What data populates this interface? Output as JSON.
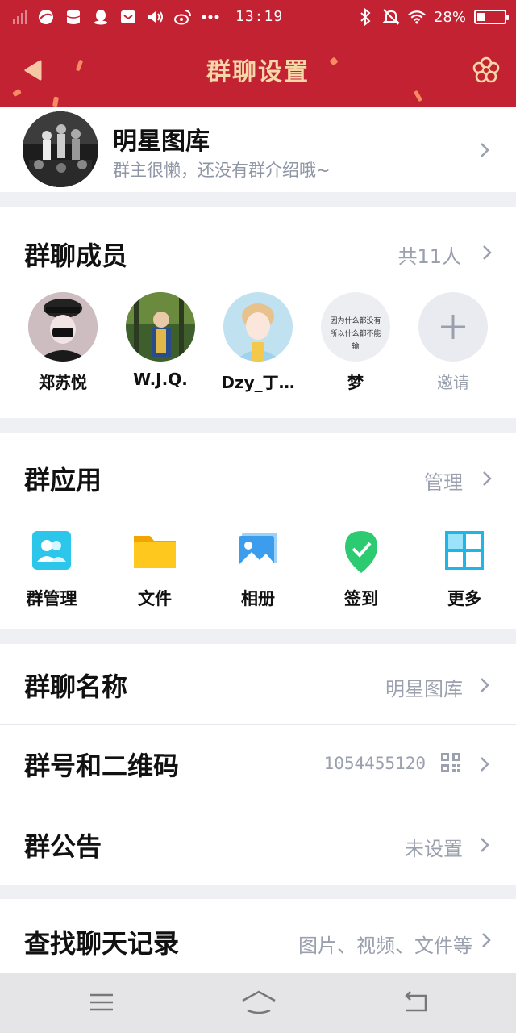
{
  "status_bar": {
    "time": "13:19",
    "battery_text": "28%",
    "battery_level": 0.28,
    "icons": [
      "signal-icon",
      "browser-icon",
      "storage-icon",
      "qq-icon",
      "mail-icon",
      "volume-icon",
      "weibo-icon",
      "more-dots-icon",
      "bluetooth-icon",
      "mute-icon",
      "wifi-icon",
      "battery-icon"
    ]
  },
  "header": {
    "title": "群聊设置"
  },
  "group": {
    "name": "明星图库",
    "description": "群主很懒，还没有群介绍哦~"
  },
  "members": {
    "title": "群聊成员",
    "count_label": "共11人",
    "list": [
      {
        "name": "郑苏悦"
      },
      {
        "name": "W.J.Q."
      },
      {
        "name": "Dzy_丁…"
      },
      {
        "name": "梦",
        "avatar_text": "因为什么都没有 所以什么都不能输"
      },
      {
        "name": "邀请"
      }
    ]
  },
  "apps": {
    "title": "群应用",
    "manage_label": "管理",
    "items": [
      {
        "label": "群管理",
        "icon": "group-manage-icon",
        "color": "#2cc6ea"
      },
      {
        "label": "文件",
        "icon": "folder-icon",
        "color": "#ffc11a"
      },
      {
        "label": "相册",
        "icon": "photo-album-icon",
        "color": "#4aa8ee"
      },
      {
        "label": "签到",
        "icon": "check-in-icon",
        "color": "#2ccb72"
      },
      {
        "label": "更多",
        "icon": "grid-more-icon",
        "color": "#1fb5e6"
      }
    ]
  },
  "settings": {
    "group_name": {
      "title": "群聊名称",
      "value": "明星图库"
    },
    "group_number": {
      "title": "群号和二维码",
      "value": "1054455120"
    },
    "announcement": {
      "title": "群公告",
      "value": "未设置"
    },
    "search_history": {
      "title": "查找聊天记录",
      "value": "图片、视频、文件等"
    }
  },
  "navbar": {
    "icons": [
      "menu-icon",
      "home-icon",
      "back-icon"
    ]
  },
  "colors": {
    "header_bg": "#c32233",
    "title_color": "#f6d7a8",
    "muted_text": "#9aa0ad"
  }
}
